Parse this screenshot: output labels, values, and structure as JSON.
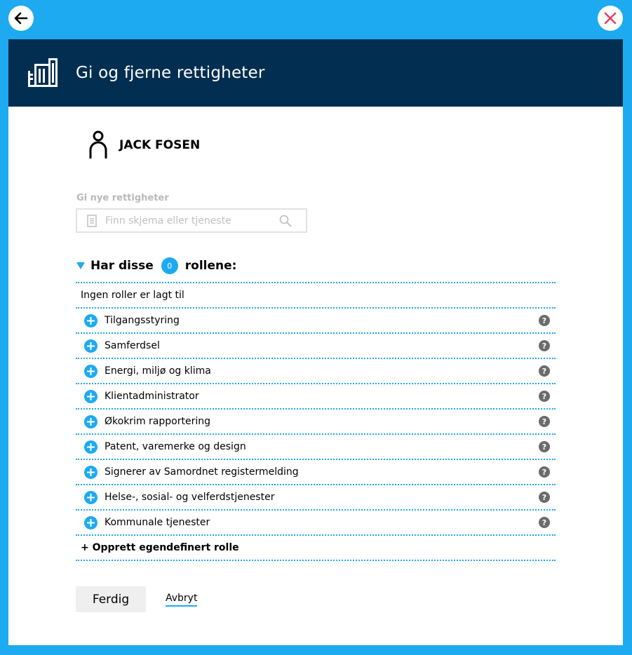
{
  "header": {
    "title": "Gi og fjerne rettigheter"
  },
  "user": {
    "name": "JACK FOSEN"
  },
  "search": {
    "label": "Gi nye rettigheter",
    "placeholder": "Finn skjema eller tjeneste"
  },
  "roles": {
    "heading_pre": "Har disse",
    "count": "0",
    "heading_post": "rollene:",
    "empty_text": "Ingen roller er lagt til",
    "available": [
      {
        "label": "Tilgangsstyring"
      },
      {
        "label": "Samferdsel"
      },
      {
        "label": "Energi, miljø og klima"
      },
      {
        "label": "Klientadministrator"
      },
      {
        "label": "Økokrim rapportering"
      },
      {
        "label": "Patent, varemerke og design"
      },
      {
        "label": "Signerer av Samordnet registermelding"
      },
      {
        "label": "Helse-, sosial- og velferdstjenester"
      },
      {
        "label": "Kommunale tjenester"
      }
    ],
    "help_glyph": "?",
    "create_label": "+ Opprett egendefinert rolle"
  },
  "actions": {
    "done_label": "Ferdig",
    "cancel_label": "Avbryt"
  },
  "colors": {
    "accent": "#1eaaf1",
    "header_bg": "#022f51",
    "close_x": "#e0415f"
  },
  "icons": [
    "back-arrow-icon",
    "close-icon",
    "building-icon",
    "user-icon",
    "document-icon",
    "search-icon",
    "triangle-down-icon",
    "plus-icon",
    "help-icon"
  ]
}
